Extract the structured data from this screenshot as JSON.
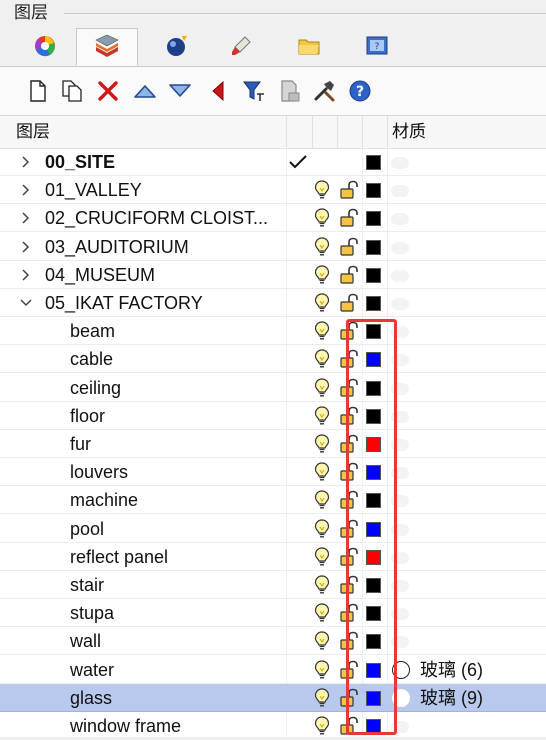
{
  "panel": {
    "title": "图层"
  },
  "tabs": [
    {
      "name": "color-wheel-icon"
    },
    {
      "name": "layers-icon"
    },
    {
      "name": "render-sphere-icon"
    },
    {
      "name": "brush-icon"
    },
    {
      "name": "folder-icon"
    },
    {
      "name": "display-icon"
    }
  ],
  "toolbar": [
    "new-layer-icon",
    "new-sublayer-icon",
    "delete-icon",
    "move-up-icon",
    "move-down-icon",
    "move-left-icon",
    "filter-icon",
    "clipboard-icon",
    "tools-icon",
    "help-icon"
  ],
  "columns": {
    "name": "图层",
    "material": "材质"
  },
  "layers": [
    {
      "label": "00_SITE",
      "level": 0,
      "bold": true,
      "current": true,
      "color": "#000000"
    },
    {
      "label": "01_VALLEY",
      "level": 0,
      "color": "#000000"
    },
    {
      "label": "02_CRUCIFORM CLOIST...",
      "level": 0,
      "color": "#000000"
    },
    {
      "label": "03_AUDITORIUM",
      "level": 0,
      "color": "#000000"
    },
    {
      "label": "04_MUSEUM",
      "level": 0,
      "color": "#000000"
    },
    {
      "label": "05_IKAT FACTORY",
      "level": 0,
      "expanded": true,
      "color": "#000000"
    },
    {
      "label": "beam",
      "level": 1,
      "color": "#000000"
    },
    {
      "label": "cable",
      "level": 1,
      "color": "#0000ff"
    },
    {
      "label": "ceiling",
      "level": 1,
      "color": "#000000"
    },
    {
      "label": "floor",
      "level": 1,
      "color": "#000000"
    },
    {
      "label": "fur",
      "level": 1,
      "color": "#ff0000"
    },
    {
      "label": "louvers",
      "level": 1,
      "color": "#0000ff"
    },
    {
      "label": "machine",
      "level": 1,
      "color": "#000000"
    },
    {
      "label": "pool",
      "level": 1,
      "color": "#0000ff"
    },
    {
      "label": "reflect panel",
      "level": 1,
      "color": "#ff0000"
    },
    {
      "label": "stair",
      "level": 1,
      "color": "#000000"
    },
    {
      "label": "stupa",
      "level": 1,
      "color": "#000000"
    },
    {
      "label": "wall",
      "level": 1,
      "color": "#000000"
    },
    {
      "label": "water",
      "level": 1,
      "color": "#0000ff",
      "material": "玻璃 (6)"
    },
    {
      "label": "glass",
      "level": 1,
      "color": "#0000ff",
      "material": "玻璃 (9)",
      "selected": true
    },
    {
      "label": "window frame",
      "level": 1,
      "color": "#0000ff"
    }
  ],
  "colors": {
    "selection": "#b9c9ee",
    "highlight_box": "#e53935"
  }
}
